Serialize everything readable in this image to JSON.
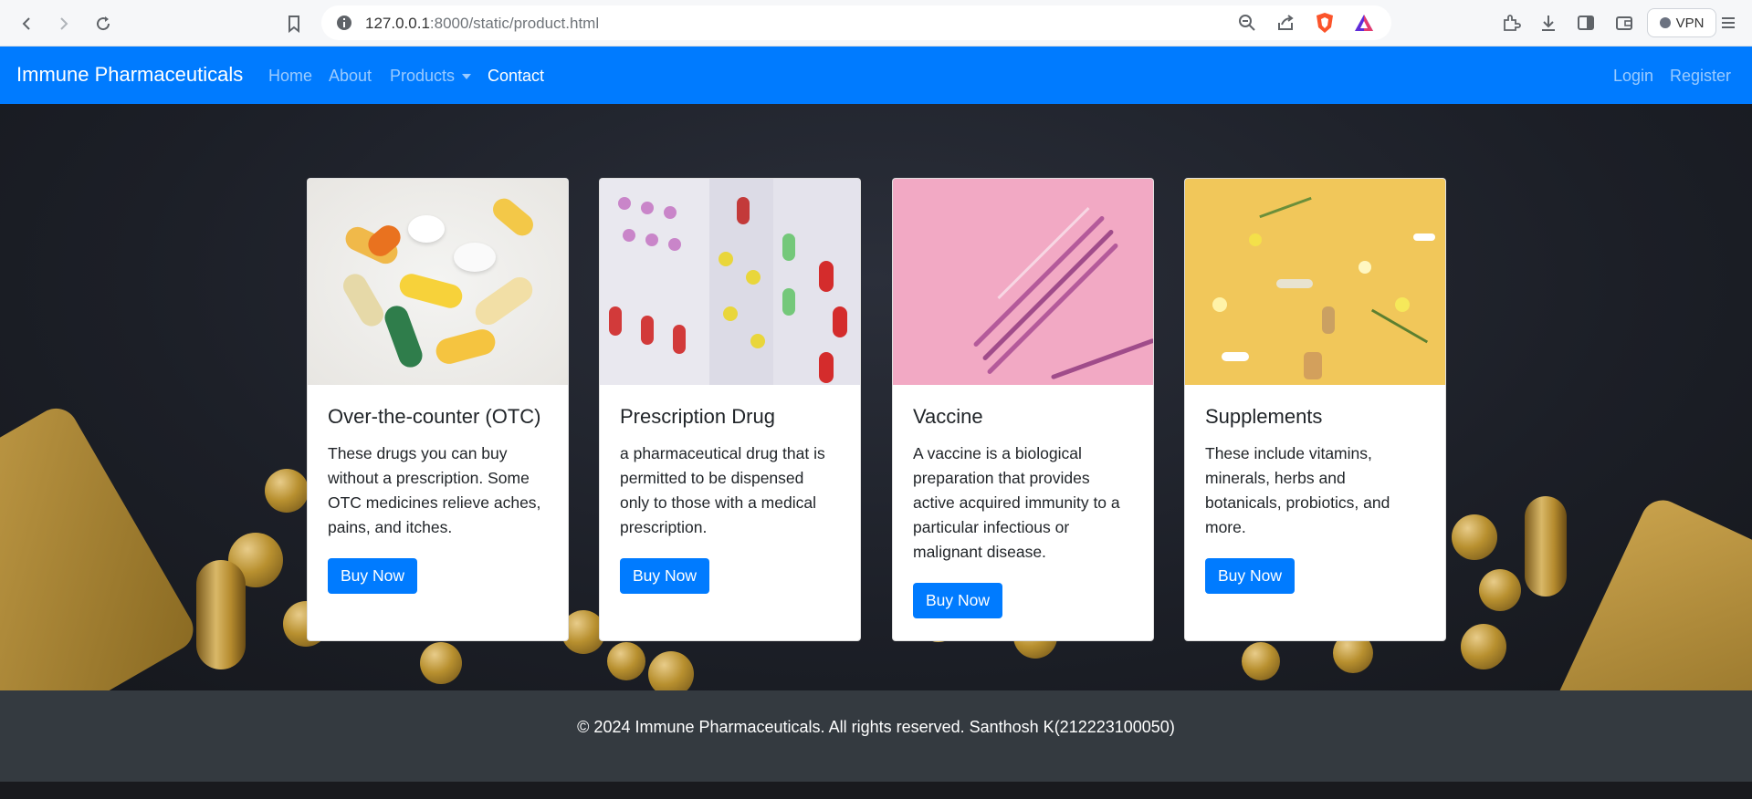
{
  "browser": {
    "url_host": "127.0.0.1",
    "url_rest": ":8000/static/product.html",
    "vpn_label": "VPN"
  },
  "navbar": {
    "brand": "Immune Pharmaceuticals",
    "links": [
      {
        "label": "Home"
      },
      {
        "label": "About"
      },
      {
        "label": "Products"
      },
      {
        "label": "Contact"
      }
    ],
    "auth": [
      {
        "label": "Login"
      },
      {
        "label": "Register"
      }
    ]
  },
  "cards": [
    {
      "title": "Over-the-counter (OTC)",
      "lines": [
        "These drugs you can buy",
        "without a prescription. Some",
        "OTC medicines relieve aches,",
        "pains, and itches."
      ],
      "button": "Buy Now"
    },
    {
      "title": "Prescription Drug",
      "lines": [
        "a pharmaceutical drug that is",
        "permitted to be dispensed",
        "only to those with a medical",
        "prescription."
      ],
      "button": "Buy Now"
    },
    {
      "title": "Vaccine",
      "lines": [
        "A vaccine is a biological",
        "preparation that provides",
        "active acquired immunity to a",
        "particular infectious or",
        "malignant disease."
      ],
      "button": "Buy Now"
    },
    {
      "title": "Supplements",
      "lines": [
        "These include vitamins,",
        "minerals, herbs and",
        "botanicals, probiotics, and",
        "more."
      ],
      "button": "Buy Now"
    }
  ],
  "footer": {
    "text": "© 2024 Immune Pharmaceuticals. All rights reserved. Santhosh K(212223100050)"
  },
  "colors": {
    "primary": "#007bff",
    "footer": "#343a40"
  }
}
